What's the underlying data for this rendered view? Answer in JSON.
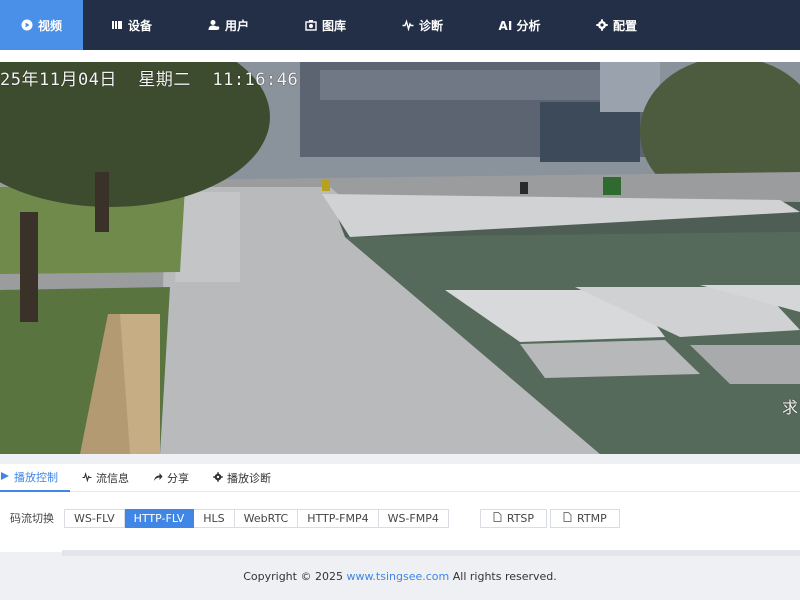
{
  "nav": {
    "items": [
      {
        "label": "视频",
        "icon": "play-circle-icon"
      },
      {
        "label": "设备",
        "icon": "device-bars-icon"
      },
      {
        "label": "用户",
        "icon": "users-icon"
      },
      {
        "label": "图库",
        "icon": "gallery-icon"
      },
      {
        "label": "诊断",
        "icon": "pulse-icon"
      },
      {
        "label": "AI 分析",
        "icon": ""
      },
      {
        "label": "配置",
        "icon": "gear-icon"
      }
    ],
    "active_index": 0,
    "colors": {
      "bar": "#232f46",
      "active": "#4a90e8"
    }
  },
  "video": {
    "osd_datetime": "25年11月04日  星期二  11:16:46",
    "osd_right": "求"
  },
  "tabs": [
    {
      "label": "播放控制",
      "icon": "play-control-icon"
    },
    {
      "label": "流信息",
      "icon": "wave-icon"
    },
    {
      "label": "分享",
      "icon": "share-icon"
    },
    {
      "label": "播放诊断",
      "icon": "gear-icon"
    }
  ],
  "stream": {
    "label": "码流切换",
    "formats": [
      "WS-FLV",
      "HTTP-FLV",
      "HLS",
      "WebRTC",
      "HTTP-FMP4",
      "WS-FMP4"
    ],
    "selected": "HTTP-FLV",
    "copy_buttons": [
      {
        "label": "RTSP",
        "icon": "document-icon"
      },
      {
        "label": "RTMP",
        "icon": "document-icon"
      }
    ]
  },
  "footer": {
    "prefix": "Copyright © 2025 ",
    "link": "www.tsingsee.com",
    "suffix": " All rights reserved."
  },
  "accent": "#3f86e6"
}
